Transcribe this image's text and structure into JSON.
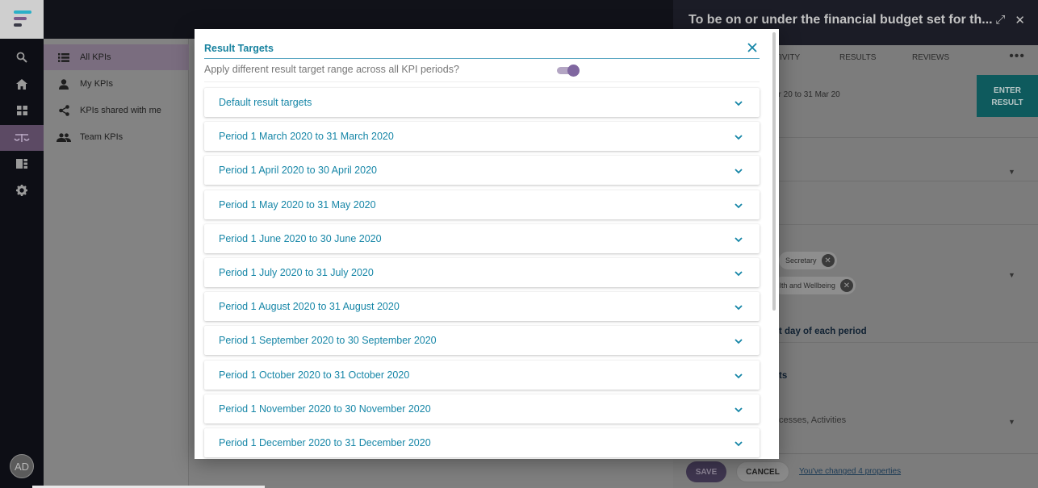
{
  "rail": {
    "logo_colors": [
      "#2bb0c7",
      "#7a5a8a",
      "#3a3a48"
    ],
    "icons": [
      "search-icon",
      "home-icon",
      "grid-icon",
      "balance-scale-icon",
      "list-icon",
      "gear-icon"
    ],
    "avatar_initials": "AD"
  },
  "subnav": {
    "items": [
      {
        "label": "All KPIs",
        "icon": "list-icon",
        "active": true
      },
      {
        "label": "My KPIs",
        "icon": "person-icon",
        "active": false
      },
      {
        "label": "KPIs shared with me",
        "icon": "share-icon",
        "active": false
      },
      {
        "label": "Team KPIs",
        "icon": "group-icon",
        "active": false
      }
    ]
  },
  "panel": {
    "title": "To be on or under the financial budget set for th...",
    "tabs": [
      "TIVITY",
      "RESULTS",
      "REVIEWS"
    ],
    "date_range": "ar 20 to 31 Mar 20",
    "enter_result_line1": "ENTER",
    "enter_result_line2": "RESULT",
    "chips": [
      "Secretary",
      "lth and Wellbeing"
    ],
    "text_period": "t day of each period",
    "text_ts": "ts",
    "text_processes": "cesses, Activities",
    "footer": {
      "save": "SAVE",
      "cancel": "CANCEL",
      "changed": "You've changed 4 properties"
    }
  },
  "modal": {
    "title": "Result Targets",
    "apply_label": "Apply different result target range across all KPI periods?",
    "toggle_on": true,
    "accent_color": "#1686a7",
    "sections": [
      {
        "label": "Default result targets"
      },
      {
        "label": "Period 1 March 2020 to 31 March 2020"
      },
      {
        "label": "Period 1 April 2020 to 30 April 2020"
      },
      {
        "label": "Period 1 May 2020 to 31 May 2020"
      },
      {
        "label": "Period 1 June 2020 to 30 June 2020"
      },
      {
        "label": "Period 1 July 2020 to 31 July 2020"
      },
      {
        "label": "Period 1 August 2020 to 31 August 2020"
      },
      {
        "label": "Period 1 September 2020 to 30 September 2020"
      },
      {
        "label": "Period 1 October 2020 to 31 October 2020"
      },
      {
        "label": "Period 1 November 2020 to 30 November 2020"
      },
      {
        "label": "Period 1 December 2020 to 31 December 2020"
      }
    ]
  }
}
